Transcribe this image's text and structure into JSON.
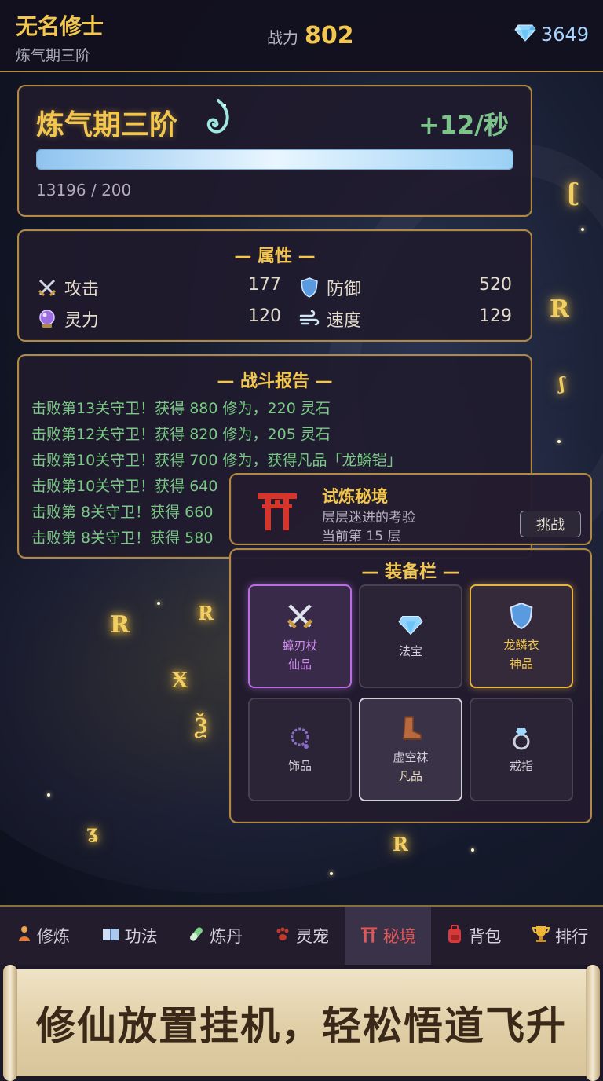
{
  "header": {
    "player_name": "无名修士",
    "player_realm": "炼气期三阶",
    "power_label": "战力",
    "power_value": "802",
    "gems_value": "3649"
  },
  "cultivation": {
    "realm": "炼气期三阶",
    "rate": "+12/秒",
    "exp": "13196 / 200",
    "progress_fraction": 1.0
  },
  "attributes": {
    "title": "— 属性 —",
    "items": [
      {
        "label": "攻击",
        "value": "177",
        "icon": "crossed-swords-icon"
      },
      {
        "label": "防御",
        "value": "520",
        "icon": "shield-icon"
      },
      {
        "label": "灵力",
        "value": "120",
        "icon": "crystal-ball-icon"
      },
      {
        "label": "速度",
        "value": "129",
        "icon": "wind-icon"
      }
    ]
  },
  "battle_report": {
    "title": "— 战斗报告 —",
    "lines": [
      "击败第13关守卫！获得 880 修为，220 灵石",
      "击败第12关守卫！获得 820 修为，205 灵石",
      "击败第10关守卫！获得 700 修为，获得凡品「龙鳞铠」",
      "击败第10关守卫！获得 640",
      "击败第 8关守卫！获得 660",
      "击败第 8关守卫！获得 580"
    ]
  },
  "dungeon": {
    "title": "试炼秘境",
    "description": "层层迷进的考验",
    "floor": "当前第 15 层",
    "challenge_label": "挑战"
  },
  "equipment": {
    "title": "— 装备栏 —",
    "slots": [
      {
        "name": "蟑刃杖",
        "grade": "仙品",
        "icon": "crossed-swords-icon",
        "rarity": "immortal"
      },
      {
        "name": "法宝",
        "grade": "",
        "icon": "diamond-icon",
        "rarity": "empty"
      },
      {
        "name": "龙鳞衣",
        "grade": "神品",
        "icon": "shield-icon",
        "rarity": "divine"
      },
      {
        "name": "饰品",
        "grade": "",
        "icon": "prayer-beads-icon",
        "rarity": "empty"
      },
      {
        "name": "虚空袜",
        "grade": "凡品",
        "icon": "boot-icon",
        "rarity": "common"
      },
      {
        "name": "戒指",
        "grade": "",
        "icon": "ring-icon",
        "rarity": "empty"
      }
    ]
  },
  "nav": {
    "items": [
      {
        "label": "修炼",
        "icon": "meditation-icon"
      },
      {
        "label": "功法",
        "icon": "book-icon"
      },
      {
        "label": "炼丹",
        "icon": "pill-icon"
      },
      {
        "label": "灵宠",
        "icon": "paw-icon"
      },
      {
        "label": "秘境",
        "icon": "torii-icon"
      },
      {
        "label": "背包",
        "icon": "backpack-icon"
      },
      {
        "label": "排行",
        "icon": "trophy-icon"
      }
    ],
    "active_index": 4
  },
  "banner": {
    "text": "修仙放置挂机，轻松悟道飞升"
  },
  "colors": {
    "gold": "#f3c74f",
    "green": "#79c985",
    "active_nav": "#e0595a",
    "panel_border": "#b08a42"
  }
}
